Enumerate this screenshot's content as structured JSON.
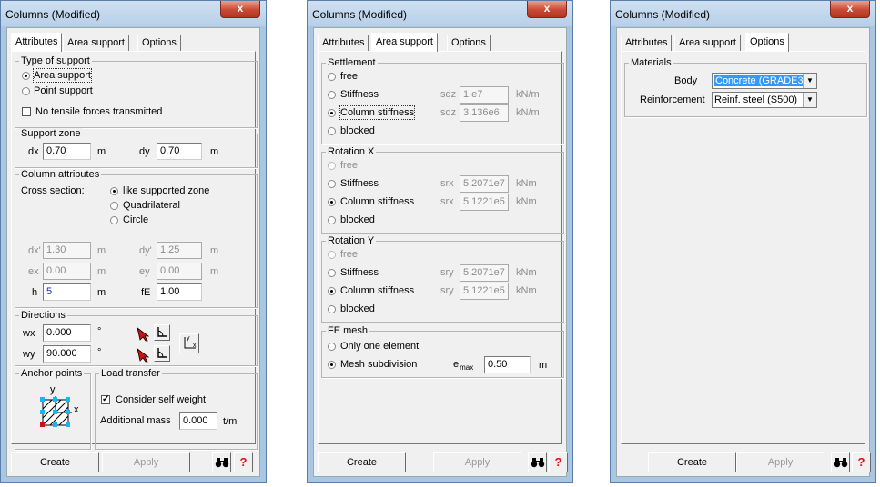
{
  "dialog_title": "Columns (Modified)",
  "close_glyph": "x",
  "tabs": [
    "Attributes",
    "Area support",
    "Options"
  ],
  "footer": {
    "create": "Create",
    "apply": "Apply",
    "help": "?"
  },
  "attributes": {
    "type_group": "Type of support",
    "area_support": "Area support",
    "point_support": "Point support",
    "no_tensile": "No tensile forces transmitted",
    "support_zone": "Support zone",
    "dx": {
      "label": "dx",
      "value": "0.70",
      "unit": "m"
    },
    "dy": {
      "label": "dy",
      "value": "0.70",
      "unit": "m"
    },
    "column_attr": "Column attributes",
    "cross_section": "Cross section:",
    "like_zone": "like supported zone",
    "quadrilateral": "Quadrilateral",
    "circle": "Circle",
    "dx2": {
      "label": "dx'",
      "value": "1.30",
      "unit": "m"
    },
    "dy2": {
      "label": "dy'",
      "value": "1.25",
      "unit": "m"
    },
    "ex": {
      "label": "ex",
      "value": "0.00",
      "unit": "m"
    },
    "ey": {
      "label": "ey",
      "value": "0.00",
      "unit": "m"
    },
    "h": {
      "label": "h",
      "value": "5",
      "unit": "m"
    },
    "fe": {
      "label": "fE",
      "value": "1.00"
    },
    "directions": "Directions",
    "wx": {
      "label": "wx",
      "value": "0.000",
      "unit": "°"
    },
    "wy": {
      "label": "wy",
      "value": "90.000",
      "unit": "°"
    },
    "anchor": "Anchor points",
    "anchor_y": "y",
    "anchor_x": "x",
    "axis_y": "y",
    "axis_x": "x",
    "load_transfer": "Load transfer",
    "self_weight": "Consider self weight",
    "add_mass": {
      "label": "Additional mass",
      "value": "0.000",
      "unit": "t/m"
    }
  },
  "area_support": {
    "settlement": "Settlement",
    "free": "free",
    "stiffness": "Stiffness",
    "column_stiffness": "Column stiffness",
    "blocked": "blocked",
    "sdz1": "1.e7",
    "sdz2": "3.136e6",
    "sdz_label": "sdz",
    "unit_kn_m": "kN/m",
    "rotation_x": "Rotation X",
    "srx1": "5.2071e7",
    "srx2": "5.1221e5",
    "srx_label": "srx",
    "rotation_y": "Rotation Y",
    "sry1": "5.2071e7",
    "sry2": "5.1221e5",
    "sry_label": "sry",
    "unit_knm": "kNm",
    "fe_mesh": "FE mesh",
    "one_element": "Only one element",
    "mesh_subdivision": "Mesh subdivision",
    "emax_label": "e",
    "emax_sub": "max",
    "emax_value": "0.50",
    "emax_unit": "m"
  },
  "options": {
    "materials": "Materials",
    "body_label": "Body",
    "body_value": "Concrete (GRADE3",
    "reinf_label": "Reinforcement",
    "reinf_value": "Reinf. steel (S500)"
  }
}
